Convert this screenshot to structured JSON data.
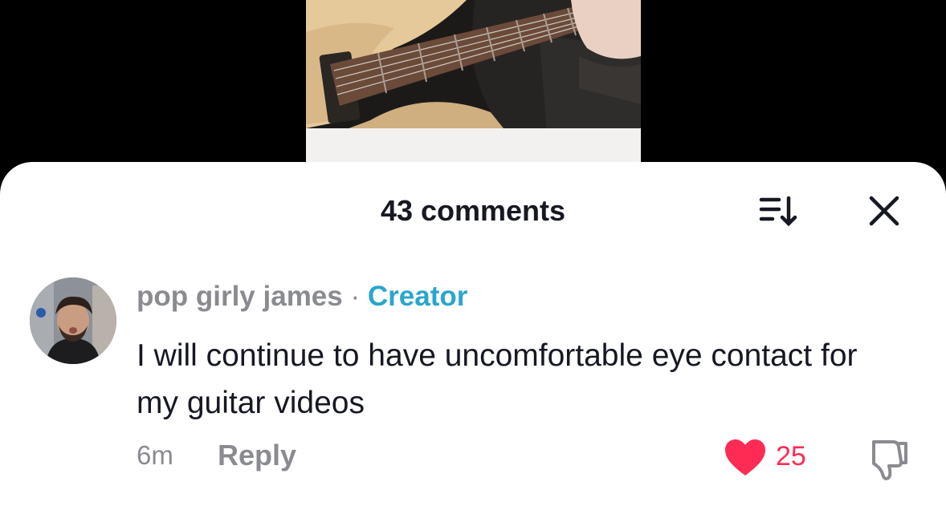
{
  "header": {
    "title": "43 comments",
    "sort_icon": "sort-down-icon",
    "close_icon": "close-icon"
  },
  "video": {
    "description_icon": "guitar-video-thumbnail"
  },
  "comment": {
    "username": "pop girly james",
    "separator": "·",
    "badge": "Creator",
    "text": "I will continue to have uncomfortable eye contact for my guitar videos",
    "time": "6m",
    "reply_label": "Reply",
    "likes": "25",
    "liked": true
  },
  "colors": {
    "accent": "#fe2c55",
    "creator": "#2aa6cd",
    "muted": "#8a8b91",
    "text": "#161823"
  }
}
